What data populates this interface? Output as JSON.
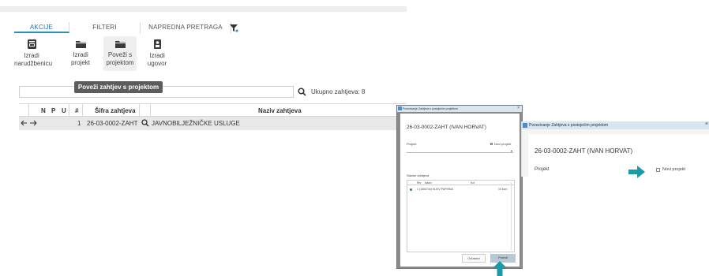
{
  "tabs": [
    {
      "label": "AKCIJE",
      "active": true
    },
    {
      "label": "FILTERI",
      "active": false
    },
    {
      "label": "NAPREDNA PRETRAGA",
      "active": false
    }
  ],
  "toolbar": [
    {
      "label": "Izradi\nnarudžbenicu",
      "icon": "cart-icon"
    },
    {
      "label": "Izradi\nprojekt",
      "icon": "folder-icon"
    },
    {
      "label": "Poveži s\nprojektom",
      "icon": "folder-link-icon"
    },
    {
      "label": "Izradi\nugovor",
      "icon": "contract-icon"
    }
  ],
  "tooltip": "Poveži zahtjev s projektom",
  "search": {
    "value": "",
    "total": "Ukupno zahtjeva: 8"
  },
  "grid": {
    "headers": {
      "n": "N",
      "p": "P",
      "u": "U",
      "num": "#",
      "sifra": "Šifra zahtjeva",
      "naziv": "Naziv zahtjeva"
    },
    "row": {
      "num": "1",
      "sifra": "26-03-0002-ZAHT",
      "naziv": "JAVNOBILJEŽNIČKE USLUGE"
    }
  },
  "dialog1": {
    "title": "Povezivanje Zahtjeva s postojećim projektom",
    "heading": "26-03-0002-ZAHT (IVAN HORVAT)",
    "projekt_label": "Projekt",
    "novi_projekt": "Novi projekt",
    "stavke_label": "Stavke zahtjeva",
    "col_rbr": "Rbr",
    "col_naziv": "Naziv",
    "col_kol": "Kol",
    "item_text": "1 (1554744) KLIEV PAPIRNA",
    "item_qty": "10 kom",
    "btn_odustani": "Odustani",
    "btn_potvrdi": "Potvrdi"
  },
  "dialog2": {
    "title": "Povezivanje Zahtjeva s postojećim projektom",
    "heading": "26-03-0002-ZAHT (IVAN HORVAT)",
    "projekt_label": "Projekt",
    "novi_projekt": "Novi projekt"
  },
  "colors": {
    "accent": "#2b8fb3",
    "arrow": "#1a9ba8",
    "tooltip": "#5c5c5c"
  }
}
